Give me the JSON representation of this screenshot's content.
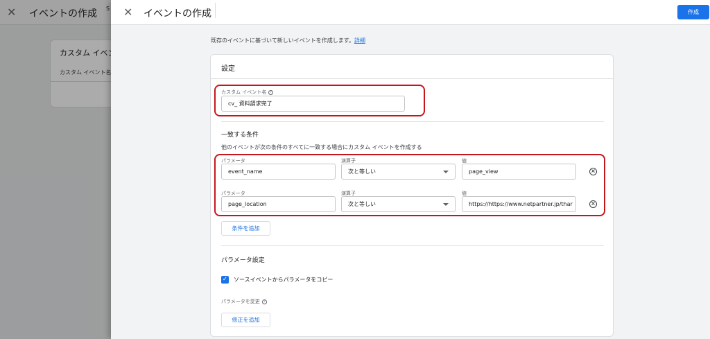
{
  "background": {
    "title": "イベントの作成",
    "stub_text": "S",
    "card_title": "カスタム イベン",
    "card_label": "カスタム イベント名"
  },
  "header": {
    "title": "イベントの作成",
    "create_label": "作成"
  },
  "intro": {
    "text": "既存のイベントに基づいて新しいイベントを作成します。",
    "link": "詳細"
  },
  "settings": {
    "title": "設定",
    "event_name_label": "カスタム イベント名",
    "event_name_value": "cv_ 資料請求完了"
  },
  "conditions": {
    "title": "一致する条件",
    "description": "他のイベントが次の条件のすべてに一致する場合にカスタム イベントを作成する",
    "param_label": "パラメータ",
    "operator_label": "演算子",
    "value_label": "値",
    "rows": [
      {
        "parameter": "event_name",
        "operator": "次と等しい",
        "value": "page_view"
      },
      {
        "parameter": "page_location",
        "operator": "次と等しい",
        "value": "https://https://www.netpartner.jp/thar"
      }
    ],
    "add_label": "条件を追加"
  },
  "param_settings": {
    "title": "パラメータ設定",
    "copy_label": "ソースイベントからパラメータをコピー",
    "copy_checked": true,
    "modify_label": "パラメータを変更",
    "add_modification_label": "修正を追加"
  },
  "colors": {
    "accent": "#1a73e8",
    "highlight": "#c4161c"
  }
}
